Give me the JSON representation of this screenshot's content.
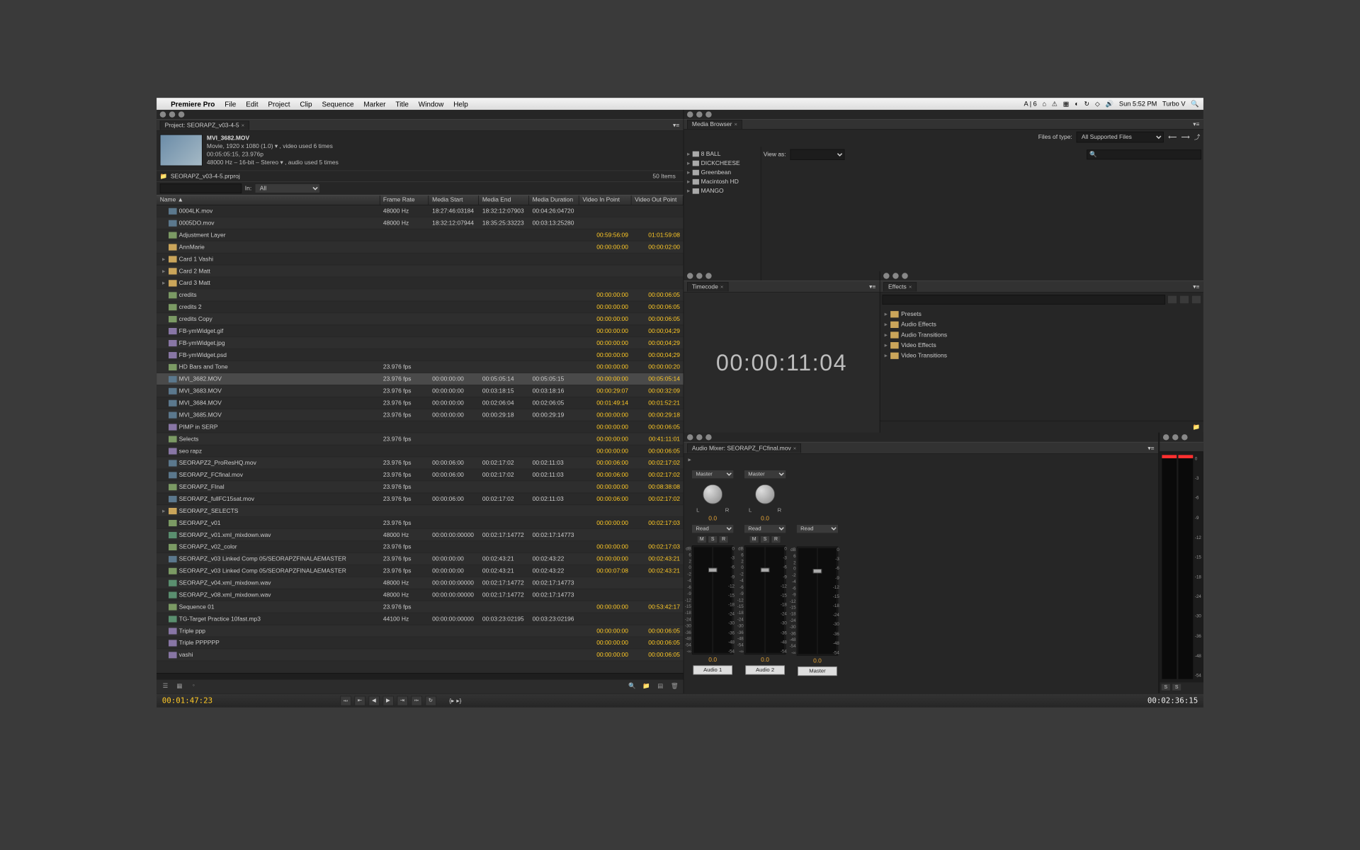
{
  "menubar": {
    "apple": "",
    "app": "Premiere Pro",
    "items": [
      "File",
      "Edit",
      "Project",
      "Clip",
      "Sequence",
      "Marker",
      "Title",
      "Window",
      "Help"
    ],
    "right_time": "Sun 5:52 PM",
    "right_user": "Turbo V"
  },
  "project": {
    "tab_label": "Project: SEORAPZ_v03-4-5",
    "clip_name": "MVI_3682.MOV",
    "meta1": "Movie, 1920 x 1080 (1.0) ▾ , video used 6 times",
    "meta2": "00:05:05:15, 23.976p",
    "meta3": "48000 Hz – 16-bit – Stereo ▾ , audio used 5 times",
    "breadcrumb": "SEORAPZ_v03-4-5.prproj",
    "items_count": "50 Items",
    "search_placeholder": "",
    "in_label": "In:",
    "in_value": "All",
    "columns": {
      "name": "Name",
      "arrow": "▲",
      "fr": "Frame Rate",
      "ms": "Media Start",
      "me": "Media End",
      "md": "Media Duration",
      "vip": "Video In Point",
      "vop": "Video Out Point"
    },
    "rows": [
      {
        "icon": "clip",
        "name": "0004LK.mov",
        "fr": "48000 Hz",
        "ms": "18:27:46:03184",
        "me": "18:32:12:07903",
        "md": "00:04:26:04720"
      },
      {
        "icon": "clip",
        "name": "0005DO.mov",
        "fr": "48000 Hz",
        "ms": "18:32:12:07944",
        "me": "18:35:25:33223",
        "md": "00:03:13:25280"
      },
      {
        "icon": "seq",
        "name": "Adjustment Layer",
        "vip": "00:59:56:09",
        "vop": "01:01:59:08"
      },
      {
        "icon": "folder",
        "name": "AnnMarie",
        "vip": "00:00:00:00",
        "vop": "00:00:02:00"
      },
      {
        "icon": "folder",
        "tw": "▸",
        "name": "Card 1 Vashi"
      },
      {
        "icon": "folder",
        "tw": "▸",
        "name": "Card 2 Matt"
      },
      {
        "icon": "folder",
        "tw": "▸",
        "name": "Card 3 Matt"
      },
      {
        "icon": "seq",
        "name": "credits",
        "vip": "00:00:00:00",
        "vop": "00:00:06:05"
      },
      {
        "icon": "seq",
        "name": "credits 2",
        "vip": "00:00:00:00",
        "vop": "00:00:06:05"
      },
      {
        "icon": "seq",
        "name": "credits Copy",
        "vip": "00:00:00:00",
        "vop": "00:00:06:05"
      },
      {
        "icon": "still",
        "name": "FB-ymWidget.gif",
        "vip": "00:00:00:00",
        "vop": "00:00;04;29"
      },
      {
        "icon": "still",
        "name": "FB-ymWidget.jpg",
        "vip": "00:00:00:00",
        "vop": "00:00;04;29"
      },
      {
        "icon": "still",
        "name": "FB-ymWidget.psd",
        "vip": "00:00:00:00",
        "vop": "00:00;04;29"
      },
      {
        "icon": "seq",
        "name": "HD Bars and Tone",
        "fr": "23.976 fps",
        "vip": "00:00:00:00",
        "vop": "00:00:00:20"
      },
      {
        "icon": "clip",
        "sel": true,
        "name": "MVI_3682.MOV",
        "fr": "23.976 fps",
        "ms": "00:00:00:00",
        "me": "00:05:05:14",
        "md": "00:05:05:15",
        "vip": "00:00:00:00",
        "vop": "00:05:05:14"
      },
      {
        "icon": "clip",
        "name": "MVI_3683.MOV",
        "fr": "23.976 fps",
        "ms": "00:00:00:00",
        "me": "00:03:18:15",
        "md": "00:03:18:16",
        "vip": "00:00:29:07",
        "vop": "00:00:32:09"
      },
      {
        "icon": "clip",
        "name": "MVI_3684.MOV",
        "fr": "23.976 fps",
        "ms": "00:00:00:00",
        "me": "00:02:06:04",
        "md": "00:02:06:05",
        "vip": "00:01:49:14",
        "vop": "00:01:52:21"
      },
      {
        "icon": "clip",
        "name": "MVI_3685.MOV",
        "fr": "23.976 fps",
        "ms": "00:00:00:00",
        "me": "00:00:29:18",
        "md": "00:00:29:19",
        "vip": "00:00:00:00",
        "vop": "00:00:29:18"
      },
      {
        "icon": "still",
        "name": "PIMP in SERP",
        "vip": "00:00:00:00",
        "vop": "00:00:06:05"
      },
      {
        "icon": "seq",
        "name": "Selects",
        "fr": "23.976 fps",
        "vip": "00:00:00:00",
        "vop": "00:41:11:01"
      },
      {
        "icon": "still",
        "name": "seo rapz",
        "vip": "00:00:00:00",
        "vop": "00:00:06:05"
      },
      {
        "icon": "clip",
        "name": "SEORAPZ2_ProResHQ.mov",
        "fr": "23.976 fps",
        "ms": "00:00:06:00",
        "me": "00:02:17:02",
        "md": "00:02:11:03",
        "vip": "00:00:06:00",
        "vop": "00:02:17:02"
      },
      {
        "icon": "clip",
        "name": "SEORAPZ_FCfinal.mov",
        "fr": "23.976 fps",
        "ms": "00:00:06:00",
        "me": "00:02:17:02",
        "md": "00:02:11:03",
        "vip": "00:00:06:00",
        "vop": "00:02:17:02"
      },
      {
        "icon": "seq",
        "name": "SEORAPZ_FInal",
        "fr": "23.976 fps",
        "vip": "00:00:00:00",
        "vop": "00:08:38:08"
      },
      {
        "icon": "clip",
        "name": "SEORAPZ_fullFC15sat.mov",
        "fr": "23.976 fps",
        "ms": "00:00:06:00",
        "me": "00:02:17:02",
        "md": "00:02:11:03",
        "vip": "00:00:06:00",
        "vop": "00:02:17:02"
      },
      {
        "icon": "folder",
        "tw": "▸",
        "name": "SEORAPZ_SELECTS"
      },
      {
        "icon": "seq",
        "name": "SEORAPZ_v01",
        "fr": "23.976 fps",
        "vip": "00:00:00:00",
        "vop": "00:02:17:03"
      },
      {
        "icon": "audio",
        "name": "SEORAPZ_v01.xml_mixdown.wav",
        "fr": "48000 Hz",
        "ms": "00:00:00:00000",
        "me": "00:02:17:14772",
        "md": "00:02:17:14773"
      },
      {
        "icon": "seq",
        "name": "SEORAPZ_v02_color",
        "fr": "23.976 fps",
        "vip": "00:00:00:00",
        "vop": "00:02:17:03"
      },
      {
        "icon": "clip",
        "name": "SEORAPZ_v03 Linked Comp 05/SEORAPZFINALAEMASTER",
        "fr": "23.976 fps",
        "ms": "00:00:00:00",
        "me": "00:02:43:21",
        "md": "00:02:43:22",
        "vip": "00:00:00:00",
        "vop": "00:02:43:21"
      },
      {
        "icon": "seq",
        "name": "SEORAPZ_v03 Linked Comp 05/SEORAPZFINALAEMASTER",
        "fr": "23.976 fps",
        "ms": "00:00:00:00",
        "me": "00:02:43:21",
        "md": "00:02:43:22",
        "vip": "00:00:07:08",
        "vop": "00:02:43:21"
      },
      {
        "icon": "audio",
        "name": "SEORAPZ_v04.xml_mixdown.wav",
        "fr": "48000 Hz",
        "ms": "00:00:00:00000",
        "me": "00:02:17:14772",
        "md": "00:02:17:14773"
      },
      {
        "icon": "audio",
        "name": "SEORAPZ_v08.xml_mixdown.wav",
        "fr": "48000 Hz",
        "ms": "00:00:00:00000",
        "me": "00:02:17:14772",
        "md": "00:02:17:14773"
      },
      {
        "icon": "seq",
        "name": "Sequence 01",
        "fr": "23.976 fps",
        "vip": "00:00:00:00",
        "vop": "00:53:42:17"
      },
      {
        "icon": "audio",
        "name": "TG-Target Practice 10fast.mp3",
        "fr": "44100 Hz",
        "ms": "00:00:00:00000",
        "me": "00:03:23:02195",
        "md": "00:03:23:02196"
      },
      {
        "icon": "still",
        "name": "Triple ppp",
        "vip": "00:00:00:00",
        "vop": "00:00:06:05"
      },
      {
        "icon": "still",
        "name": "Triple PPPPPP",
        "vip": "00:00:00:00",
        "vop": "00:00:06:05"
      },
      {
        "icon": "still",
        "name": "vashi",
        "vip": "00:00:00:00",
        "vop": "00:00:06:05"
      }
    ]
  },
  "media_browser": {
    "tab": "Media Browser",
    "files_type_label": "Files of type:",
    "files_type_value": "All Supported Files",
    "view_as": "View as:",
    "drives": [
      "8 BALL",
      "DICKCHEESE",
      "Greenbean",
      "Macintosh HD",
      "MANGO"
    ]
  },
  "timecode": {
    "tab": "Timecode",
    "value": "00:00:11:04"
  },
  "effects": {
    "tab": "Effects",
    "search_placeholder": "",
    "folders": [
      "Presets",
      "Audio Effects",
      "Audio Transitions",
      "Video Effects",
      "Video Transitions"
    ]
  },
  "audio_mixer": {
    "tab": "Audio Mixer: SEORAPZ_FCfinal.mov",
    "channels": [
      {
        "name": "Audio 1",
        "route": "Master",
        "mode": "Read",
        "pan": "0.0",
        "val": "0.0"
      },
      {
        "name": "Audio 2",
        "route": "Master",
        "mode": "Read",
        "pan": "0.0",
        "val": "0.0"
      },
      {
        "name": "Master",
        "route": "",
        "mode": "Read",
        "pan": "",
        "val": "0.0"
      }
    ],
    "scale": [
      "dB",
      "6",
      "2",
      "0",
      "-2",
      "-4",
      "-6",
      "-9",
      "-12",
      "-15",
      "-18",
      "-24",
      "-30",
      "-36",
      "-48",
      "-54",
      "-∞"
    ],
    "scale_r": [
      "0",
      "-3",
      "-6",
      "-9",
      "-12",
      "-15",
      "-18",
      "-24",
      "-30",
      "-36",
      "-48",
      "-54"
    ]
  },
  "master_meter": {
    "scale": [
      "0",
      "-3",
      "-6",
      "-9",
      "-12",
      "-15",
      "-18",
      "-24",
      "-30",
      "-36",
      "-48",
      "-54"
    ]
  },
  "footer": {
    "tc_left": "00:01:47:23",
    "tc_right": "00:02:36:15",
    "transport": [
      "⤟",
      "⇤",
      "◀",
      "▶",
      "⇥",
      "⤠",
      "↻"
    ]
  }
}
